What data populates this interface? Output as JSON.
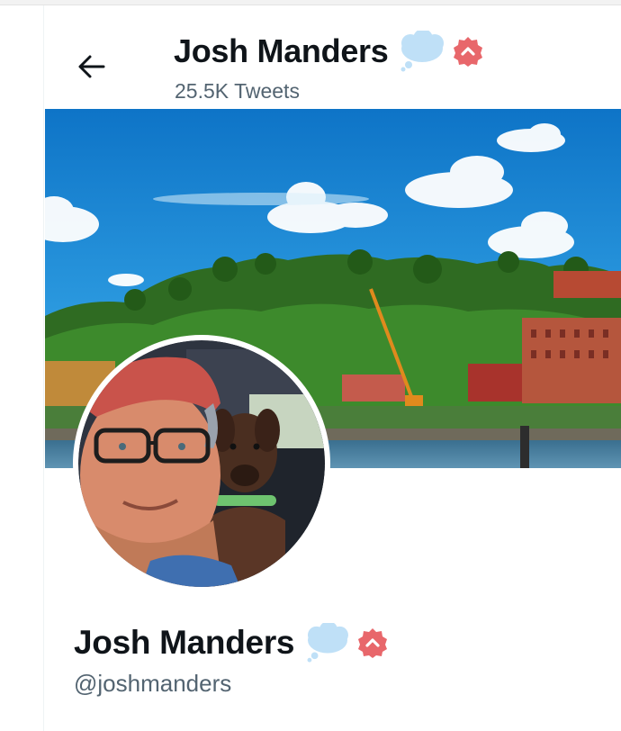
{
  "header": {
    "back_icon": "arrow-left-icon",
    "name": "Josh Manders",
    "tweet_count": "25.5K Tweets",
    "name_emoji": "thought-balloon-emoji",
    "name_badge": "red-badge-icon"
  },
  "profile": {
    "name": "Josh Manders",
    "handle": "@joshmanders",
    "name_emoji": "thought-balloon-emoji",
    "name_badge": "red-badge-icon"
  },
  "colors": {
    "text_primary": "#0f1419",
    "text_secondary": "#536471",
    "badge_red": "#e8676b",
    "cloud_blue": "#bfe0f7"
  }
}
